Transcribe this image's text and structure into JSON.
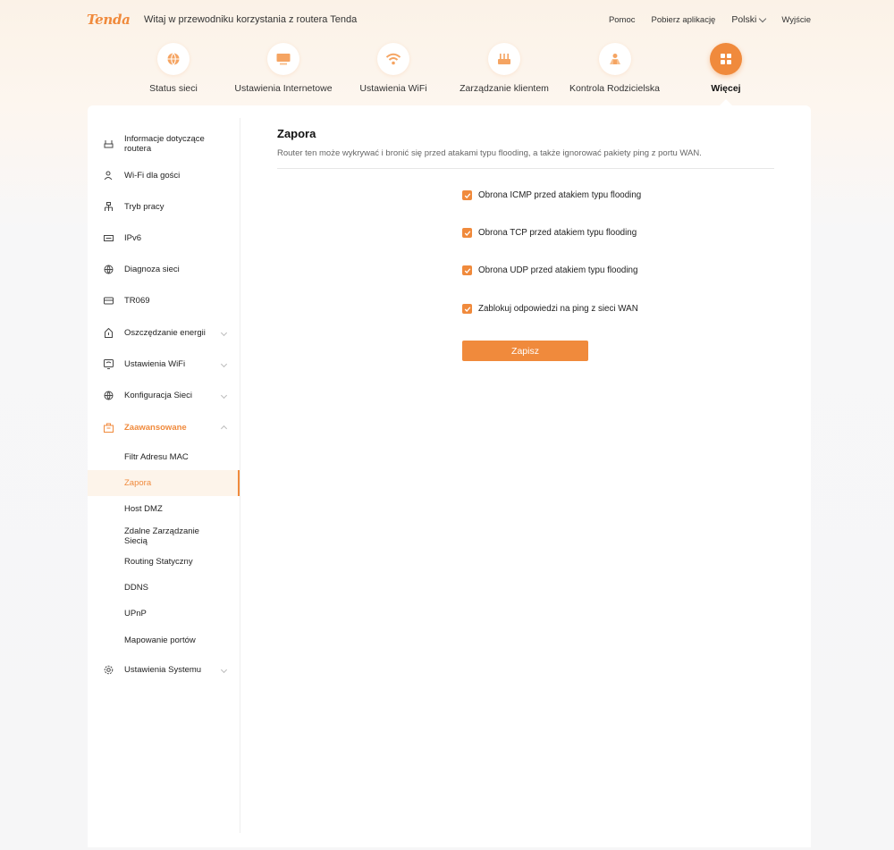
{
  "header": {
    "logo": "Tenda",
    "welcome": "Witaj w przewodniku korzystania z routera Tenda",
    "links": {
      "help": "Pomoc",
      "download": "Pobierz aplikację",
      "language": "Polski",
      "logout": "Wyjście"
    }
  },
  "nav": {
    "items": [
      {
        "label": "Status sieci",
        "icon": "globe-icon"
      },
      {
        "label": "Ustawienia Internetowe",
        "icon": "monitor-icon"
      },
      {
        "label": "Ustawienia WiFi",
        "icon": "wifi-icon"
      },
      {
        "label": "Zarządzanie klientem",
        "icon": "router-icon"
      },
      {
        "label": "Kontrola Rodzicielska",
        "icon": "family-icon"
      },
      {
        "label": "Więcej",
        "icon": "grid-icon",
        "active": true
      }
    ]
  },
  "sidebar": {
    "items": [
      {
        "label": "Informacje dotyczące routera",
        "icon": "router-info-icon"
      },
      {
        "label": "Wi-Fi dla gości",
        "icon": "guest-icon"
      },
      {
        "label": "Tryb pracy",
        "icon": "mode-icon"
      },
      {
        "label": "IPv6",
        "icon": "ipv6-icon"
      },
      {
        "label": "Diagnoza sieci",
        "icon": "globe-icon"
      },
      {
        "label": "TR069",
        "icon": "card-icon"
      },
      {
        "label": "Oszczędzanie energii",
        "icon": "energy-icon"
      },
      {
        "label": "Ustawienia WiFi",
        "icon": "wifi-settings-icon"
      },
      {
        "label": "Konfiguracja Sieci",
        "icon": "network-icon"
      },
      {
        "label": "Zaawansowane",
        "icon": "advanced-icon"
      },
      {
        "label": "Ustawienia Systemu",
        "icon": "gear-icon"
      }
    ],
    "subitems": [
      {
        "label": "Filtr Adresu MAC"
      },
      {
        "label": "Zapora"
      },
      {
        "label": "Host DMZ"
      },
      {
        "label": "Zdalne Zarządzanie Siecią"
      },
      {
        "label": "Routing Statyczny"
      },
      {
        "label": "DDNS"
      },
      {
        "label": "UPnP"
      },
      {
        "label": "Mapowanie portów"
      }
    ]
  },
  "content": {
    "title": "Zapora",
    "description": "Router ten może wykrywać i bronić się przed atakami typu flooding, a także ignorować pakiety ping z portu WAN.",
    "options": [
      {
        "label": "Obrona ICMP przed atakiem typu flooding",
        "checked": true
      },
      {
        "label": "Obrona TCP przed atakiem typu flooding",
        "checked": true
      },
      {
        "label": "Obrona UDP przed atakiem typu flooding",
        "checked": true
      },
      {
        "label": "Zablokuj odpowiedzi na ping z sieci WAN",
        "checked": true
      }
    ],
    "save_label": "Zapisz"
  },
  "colors": {
    "accent": "#f08a3c",
    "active_bg": "#fdf4ea"
  }
}
